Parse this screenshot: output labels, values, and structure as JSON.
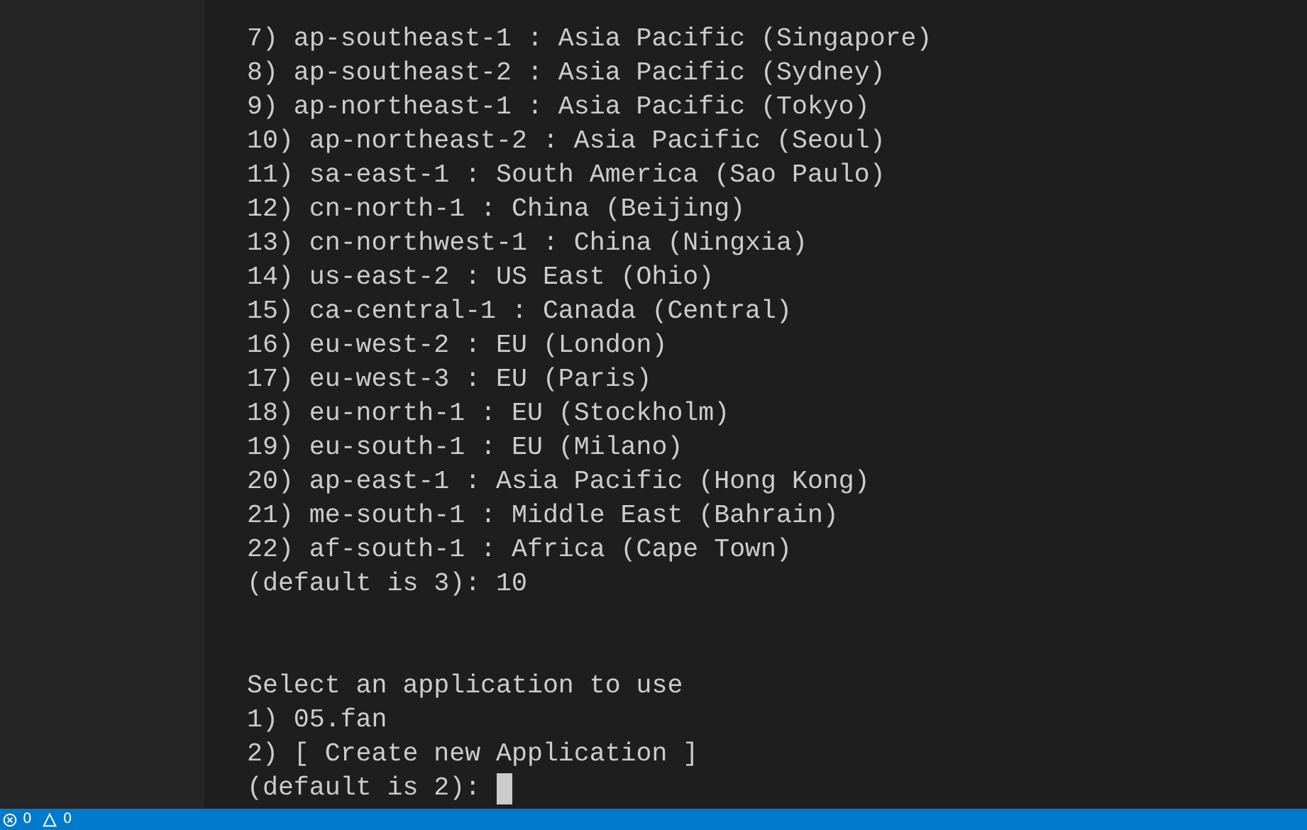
{
  "terminal": {
    "region_options": [
      "7) ap-southeast-1 : Asia Pacific (Singapore)",
      "8) ap-southeast-2 : Asia Pacific (Sydney)",
      "9) ap-northeast-1 : Asia Pacific (Tokyo)",
      "10) ap-northeast-2 : Asia Pacific (Seoul)",
      "11) sa-east-1 : South America (Sao Paulo)",
      "12) cn-north-1 : China (Beijing)",
      "13) cn-northwest-1 : China (Ningxia)",
      "14) us-east-2 : US East (Ohio)",
      "15) ca-central-1 : Canada (Central)",
      "16) eu-west-2 : EU (London)",
      "17) eu-west-3 : EU (Paris)",
      "18) eu-north-1 : EU (Stockholm)",
      "19) eu-south-1 : EU (Milano)",
      "20) ap-east-1 : Asia Pacific (Hong Kong)",
      "21) me-south-1 : Middle East (Bahrain)",
      "22) af-south-1 : Africa (Cape Town)"
    ],
    "region_prompt": "(default is 3): 10",
    "application_heading": "Select an application to use",
    "application_options": [
      "1) 05.fan",
      "2) [ Create new Application ]"
    ],
    "application_prompt": "(default is 2):"
  },
  "status_bar": {
    "errors": "0",
    "warnings": "0"
  }
}
